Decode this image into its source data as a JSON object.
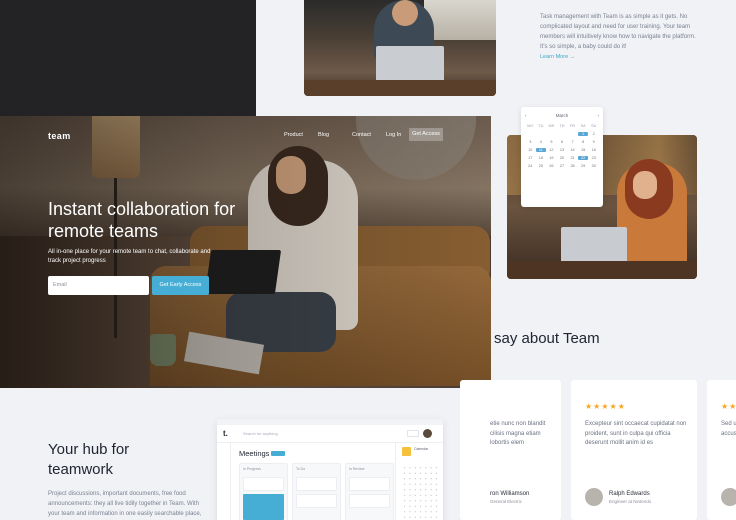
{
  "feature": {
    "text": "Task management with Team is as simple as it gets. No complicated layout and need for user training. Your team members will intuitively know how to navigate the platform. It's so simple, a baby could do it!",
    "learn_more": "Learn More →"
  },
  "hero": {
    "logo": "team",
    "nav": [
      "Product",
      "Blog",
      "Contact",
      "Log In"
    ],
    "nav_cta": "Get Access",
    "title": "Instant collaboration for remote teams",
    "subtitle": "All in-one place for your remote team to chat, collaborate and track project progress",
    "email_placeholder": "Email",
    "cta": "Get Early Access"
  },
  "calendar": {
    "month": "March",
    "prev_icon": "‹",
    "next_icon": "›",
    "days_of_week": [
      "MO",
      "TU",
      "WE",
      "TH",
      "FR",
      "SA",
      "SU"
    ],
    "rows": [
      [
        "",
        "",
        "",
        "",
        "",
        "1",
        "2"
      ],
      [
        "3",
        "4",
        "5",
        "6",
        "7",
        "8",
        "9"
      ],
      [
        "10",
        "11",
        "12",
        "13",
        "14",
        "15",
        "16"
      ],
      [
        "17",
        "18",
        "19",
        "20",
        "21",
        "22",
        "23"
      ],
      [
        "24",
        "25",
        "26",
        "27",
        "28",
        "29",
        "30"
      ]
    ],
    "selected": [
      "1",
      "11",
      "22"
    ]
  },
  "testimonials": {
    "heading": "say about Team",
    "cards": [
      {
        "stars": "",
        "quote": "etie nunc non blandit cilisis magna etiam lobortis elem",
        "name": "ron Williamson",
        "role": "General Electric"
      },
      {
        "stars": "★★★★★",
        "quote": "Excepteur sint occaecat cupidatat non proident, sunt in culpa qui officia deserunt mollit anim id es",
        "name": "Ralph Edwards",
        "role": "Engineer at Nintendo"
      },
      {
        "stars": "★★",
        "quote": "Sed u accus",
        "name": "",
        "role": ""
      }
    ]
  },
  "hub": {
    "title": "Your hub for teamwork",
    "text": "Project discussions, important documents, free food announcements: they all live tidily together in Team. With your team and information in one easily searchable place,"
  },
  "app_preview": {
    "logo": "t.",
    "search_placeholder": "Search for anything",
    "title": "Meetings",
    "columns": [
      "In Progress",
      "To Do",
      "In Review"
    ],
    "side_label": "Calendar"
  },
  "colors": {
    "accent": "#46aed4",
    "star": "#f5a623",
    "dark": "#232325"
  }
}
